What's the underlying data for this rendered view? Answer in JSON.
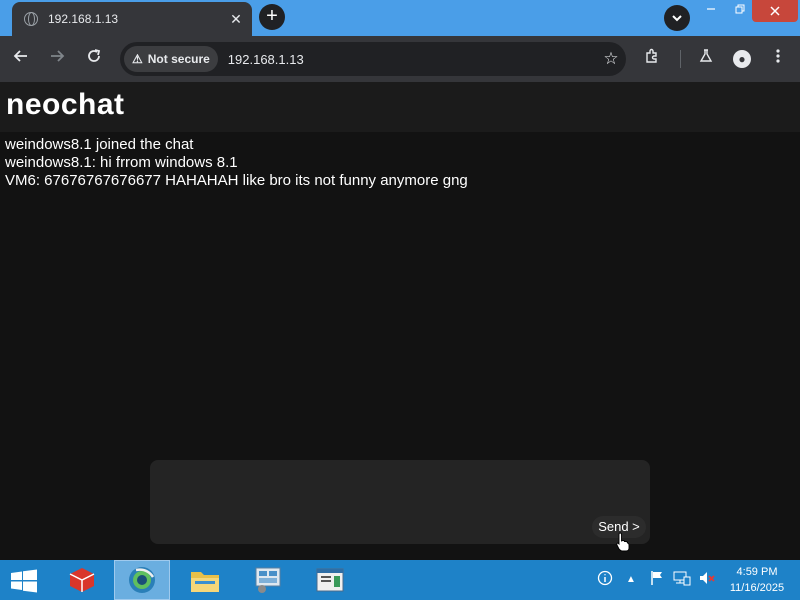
{
  "browser": {
    "tab_title": "192.168.1.13",
    "tab_close": "✕",
    "new_tab": "+",
    "security_label": "Not secure",
    "url": "192.168.1.13"
  },
  "page": {
    "title": "neochat",
    "messages": [
      "weindows8.1 joined the chat",
      "weindows8.1: hi frrom windows 8.1",
      "VM6: 67676767676677 HAHAHAH like bro its not funny anymore gng"
    ],
    "composer_value": "",
    "send_label": "Send >"
  },
  "taskbar": {
    "time": "4:59 PM",
    "date": "11/16/2025"
  },
  "colors": {
    "tabstrip": "#4a9ee8",
    "taskbar": "#1e82c8",
    "page_bg": "#121212"
  }
}
